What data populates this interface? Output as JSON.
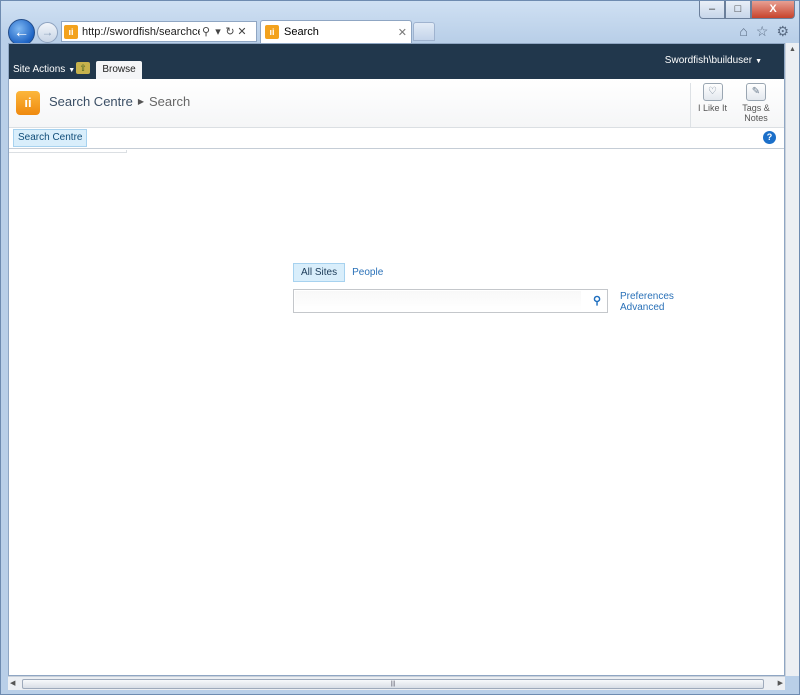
{
  "browser": {
    "address_url": "http://swordfish/searchcentre/",
    "tab_title": "Search",
    "back_glyph": "←",
    "forward_glyph": "→"
  },
  "window_controls": {
    "minimize": "–",
    "maximize": "□",
    "close": "X"
  },
  "ribbon": {
    "site_actions": "Site Actions",
    "browse_tab": "Browse",
    "user": "Swordfish\\builduser"
  },
  "title_area": {
    "site": "Search Centre",
    "page": "Search",
    "i_like_it": "I Like It",
    "tags_notes_1": "Tags &",
    "tags_notes_2": "Notes"
  },
  "topnav": {
    "item": "Search Centre",
    "help": "?"
  },
  "search": {
    "scopes": [
      "All Sites",
      "People"
    ],
    "query": "",
    "preferences": "Preferences",
    "advanced": "Advanced"
  },
  "icons": {
    "back": "back-arrow-icon",
    "home": "home-icon",
    "favorites": "star-icon",
    "tools": "gear-icon",
    "search_go": "magnifier-icon",
    "help": "help-icon"
  },
  "colors": {
    "ribbon": "#21374c",
    "accent_link": "#2a71b8",
    "highlight": "#d9eefb",
    "logo": "#f3a21d"
  }
}
